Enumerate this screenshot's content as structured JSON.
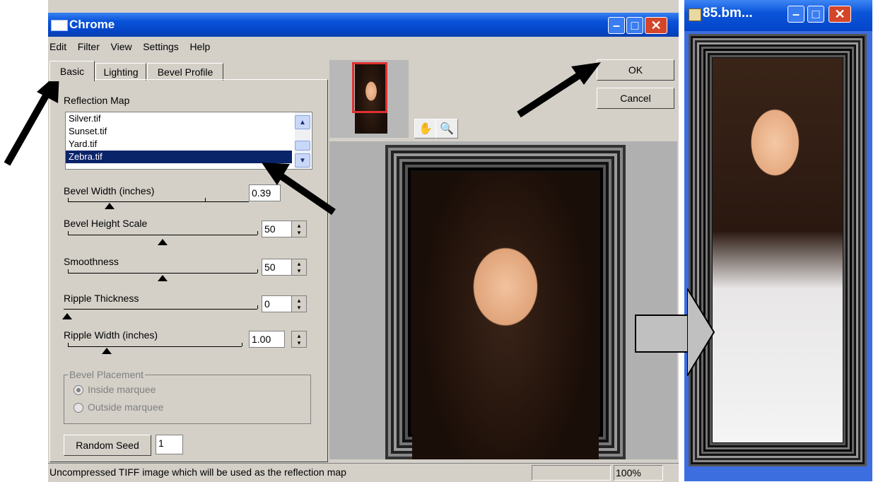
{
  "window": {
    "title": "Chrome",
    "menu": [
      "Edit",
      "Filter",
      "View",
      "Settings",
      "Help"
    ],
    "tabs": [
      "Basic",
      "Lighting",
      "Bevel Profile"
    ],
    "reflection_map": {
      "label": "Reflection Map",
      "items": [
        "Silver.tif",
        "Sunset.tif",
        "Yard.tif",
        "Zebra.tif"
      ],
      "selected": "Zebra.tif"
    },
    "sliders": [
      {
        "label": "Bevel Width (inches)",
        "value": "0.39",
        "level": 0.17
      },
      {
        "label": "Bevel Height Scale",
        "value": "50",
        "level": 0.5
      },
      {
        "label": "Smoothness",
        "value": "50",
        "level": 0.5
      },
      {
        "label": "Ripple Thickness",
        "value": "0",
        "level": 0.0
      },
      {
        "label": "Ripple Width (inches)",
        "value": "1.00",
        "level": 0.24
      }
    ],
    "bevel_placement": {
      "title": "Bevel Placement",
      "options": [
        "Inside marquee",
        "Outside marquee"
      ],
      "selected": "Inside marquee"
    },
    "random_seed": {
      "label": "Random Seed",
      "value": "1"
    },
    "buttons": {
      "ok": "OK",
      "cancel": "Cancel"
    },
    "status": {
      "text": "Uncompressed TIFF image which will be used as the reflection map",
      "zoom": "100%"
    }
  },
  "right_window": {
    "title": "85.bm..."
  },
  "icons": {
    "hand": "hand-tool-icon",
    "zoom": "zoom-tool-icon"
  }
}
